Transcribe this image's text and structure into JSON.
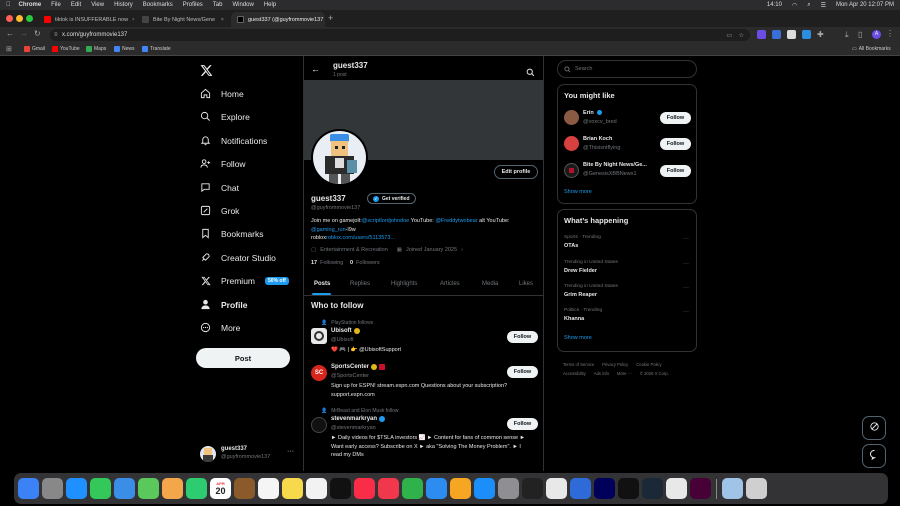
{
  "menubar": {
    "app": "Chrome",
    "items": [
      "File",
      "Edit",
      "View",
      "History",
      "Bookmarks",
      "Profiles",
      "Tab",
      "Window",
      "Help"
    ],
    "battery_time": "14:10",
    "datetime": "Mon Apr 20  12:07 PM"
  },
  "tabs": [
    {
      "label": "tiktok is INSUFFERABLE now",
      "color": "#ff0000"
    },
    {
      "label": "Bite By Night News/Gene",
      "color": "#444444"
    },
    {
      "label": "guest337 (@guyfrommovie137",
      "color": "#000000"
    }
  ],
  "address": {
    "url": "x.com/guyfrommovie137"
  },
  "bookmarks": [
    {
      "label": "Gmail",
      "color": "#ea4335"
    },
    {
      "label": "YouTube",
      "color": "#ff0000"
    },
    {
      "label": "Maps",
      "color": "#34a853"
    },
    {
      "label": "News",
      "color": "#4285f4"
    },
    {
      "label": "Translate",
      "color": "#4285f4"
    }
  ],
  "all_bookmarks": "All Bookmarks",
  "nav": {
    "home": "Home",
    "explore": "Explore",
    "notifications": "Notifications",
    "follow": "Follow",
    "chat": "Chat",
    "grok": "Grok",
    "bookmarks": "Bookmarks",
    "creator_studio": "Creator Studio",
    "premium": "Premium",
    "premium_badge": "50% off",
    "profile": "Profile",
    "more": "More",
    "post": "Post"
  },
  "account": {
    "name": "guest337",
    "handle": "@guyfrommovie137"
  },
  "profile": {
    "header_name": "guest337",
    "post_count": "1 post",
    "name": "guest337",
    "handle": "@guyfrommovie137",
    "get_verified": "Get verified",
    "edit_profile": "Edit profile",
    "bio_1a": "Join me on gamejolt:",
    "bio_1b": "@scriptlordjohndoe",
    "bio_1c": " YouTube: ",
    "bio_1d": "@Freddytwobear",
    "bio_1e": " alt YouTube:",
    "bio_2a": "@gaming_run",
    "bio_2b": "-l9w",
    "bio_3a": "roblox",
    "bio_3b": "roblox.com/users/5113573...",
    "category": "Entertainment & Recreation",
    "joined": "Joined January 2025",
    "following_count": "17",
    "following_label": "Following",
    "followers_count": "0",
    "followers_label": "Followers"
  },
  "profile_tabs": [
    "Posts",
    "Replies",
    "Highlights",
    "Articles",
    "Media",
    "Likes"
  ],
  "who_to_follow": {
    "title": "Who to follow",
    "items": [
      {
        "context": "PlayStation follows",
        "name": "Ubisoft",
        "handle": "@Ubisoft",
        "bio": "❤️ 🎮 | 👉 @UbisoftSupport",
        "follow": "Follow"
      },
      {
        "context": "",
        "name": "SportsCenter",
        "handle": "@SportsCenter",
        "bio": "Sign up for ESPN! stream.espn.com Questions about your subscription? support.espn.com",
        "follow": "Follow"
      },
      {
        "context": "MrBeast and Elon Musk follow",
        "name": "stevenmarkryan",
        "handle": "@stevenmarkryan",
        "bio": "► Daily videos for $TSLA investors 📈 ► Content for fans of common sense ► Want early access? Subscribe on X ► aka \"Solving The Money Problem\". ► I read my DMs",
        "follow": "Follow"
      }
    ]
  },
  "search": {
    "placeholder": "Search"
  },
  "you_might_like": {
    "title": "You might like",
    "items": [
      {
        "name": "Erin",
        "handle": "@voxcv_bred",
        "follow": "Follow",
        "color": "#8a5a44"
      },
      {
        "name": "Brian Koch",
        "handle": "@Thisisntflying",
        "follow": "Follow",
        "color": "#d94040"
      },
      {
        "name": "Bite By Night News/Ge...",
        "handle": "@GenesisXBBNews1",
        "follow": "Follow",
        "color": "#1a1a1a"
      }
    ],
    "show_more": "Show more"
  },
  "whats_happening": {
    "title": "What’s happening",
    "items": [
      {
        "context": "Sports · Trending",
        "topic": "OTAs"
      },
      {
        "context": "Trending in United States",
        "topic": "Drew Fielder"
      },
      {
        "context": "Trending in United States",
        "topic": "Grim Reaper"
      },
      {
        "context": "Politics · Trending",
        "topic": "Khanna"
      }
    ],
    "show_more": "Show more"
  },
  "footer": {
    "line1": [
      "Terms of Service",
      "Privacy Policy",
      "Cookie Policy"
    ],
    "line2": [
      "Accessibility",
      "Ads info",
      "More ···",
      "© 2026 X Corp."
    ]
  },
  "dock": {
    "calendar_month": "APR",
    "calendar_day": "20",
    "apps": [
      {
        "name": "finder",
        "color": "#3b82f6"
      },
      {
        "name": "launchpad",
        "color": "#888888"
      },
      {
        "name": "safari",
        "color": "#1e90ff"
      },
      {
        "name": "messages",
        "color": "#34c759"
      },
      {
        "name": "mail",
        "color": "#3a8ee6"
      },
      {
        "name": "maps",
        "color": "#5ac85a"
      },
      {
        "name": "photos",
        "color": "#f4a64a"
      },
      {
        "name": "facetime",
        "color": "#2ecc71"
      },
      {
        "name": "calendar",
        "color": "#ffffff"
      },
      {
        "name": "brown-app",
        "color": "#8b5a2b"
      },
      {
        "name": "reminders",
        "color": "#f5f5f5"
      },
      {
        "name": "notes",
        "color": "#f7d94c"
      },
      {
        "name": "freeform",
        "color": "#f2f2f2"
      },
      {
        "name": "appletv",
        "color": "#111111"
      },
      {
        "name": "music",
        "color": "#fa2d48"
      },
      {
        "name": "news",
        "color": "#f0374b"
      },
      {
        "name": "numbers",
        "color": "#2fb24c"
      },
      {
        "name": "keynote",
        "color": "#2d8cf0"
      },
      {
        "name": "pages",
        "color": "#f6a623"
      },
      {
        "name": "appstore",
        "color": "#1c8ef9"
      },
      {
        "name": "settings",
        "color": "#8e8e93"
      },
      {
        "name": "clock",
        "color": "#222222"
      },
      {
        "name": "roblox",
        "color": "#e8e8e8"
      },
      {
        "name": "blue-app",
        "color": "#2e6bd8"
      },
      {
        "name": "animate",
        "color": "#00005b"
      },
      {
        "name": "capcut",
        "color": "#111111"
      },
      {
        "name": "steam",
        "color": "#1b2838"
      },
      {
        "name": "chrome",
        "color": "#e8e8e8"
      },
      {
        "name": "dreamweaver",
        "color": "#470137"
      },
      {
        "name": "preview",
        "color": "#a0c4e8"
      },
      {
        "name": "trash",
        "color": "#cfcfcf"
      }
    ]
  }
}
